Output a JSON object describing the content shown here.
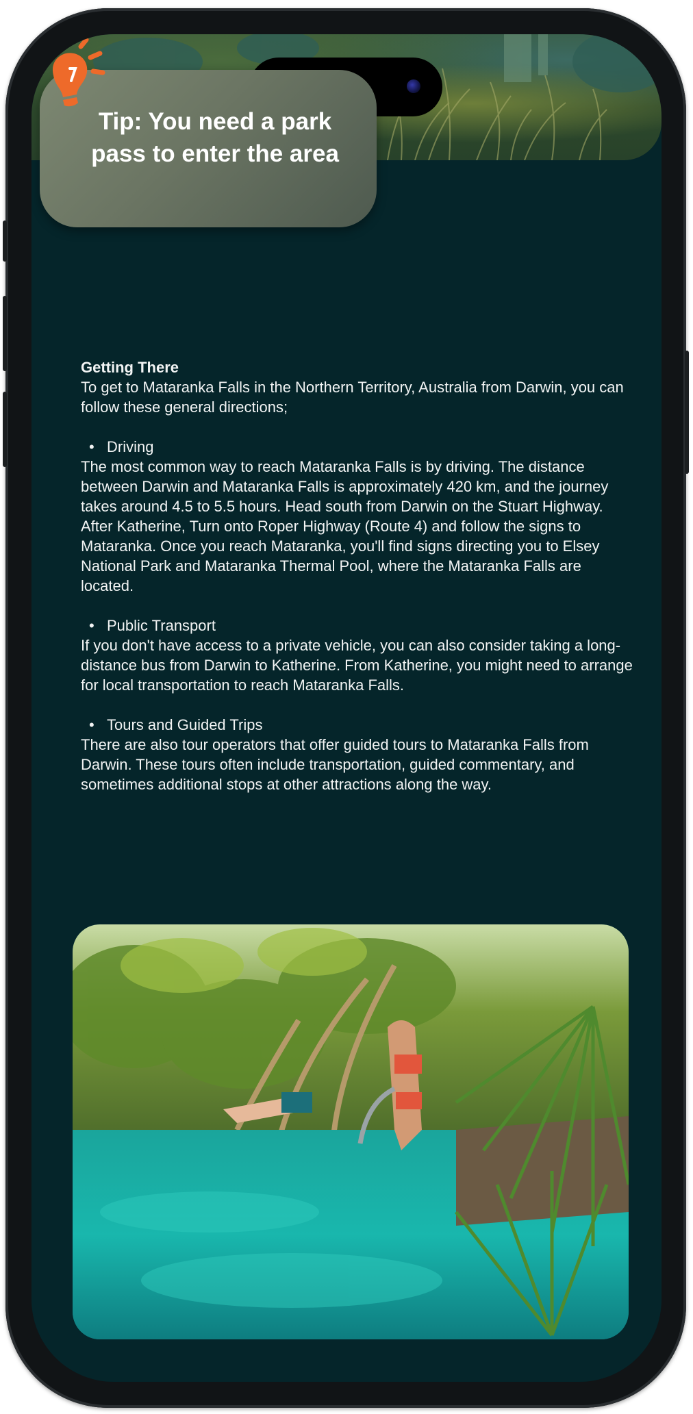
{
  "tip": {
    "line1": "Tip: You need a park",
    "line2": "pass to enter the area",
    "icon": "lightbulb-icon",
    "icon_color": "#ee6a2a"
  },
  "getting_there": {
    "heading": "Getting There",
    "intro": "To get to Mataranka Falls in the Northern Territory, Australia from Darwin, you can follow these general directions;",
    "sections": [
      {
        "title": "Driving",
        "body": "The most common way to reach Mataranka Falls is by driving. The distance between Darwin and Mataranka Falls is approximately 420 km, and the journey takes around 4.5 to 5.5 hours. Head south from Darwin on the Stuart Highway. After Katherine, Turn onto Roper Highway (Route 4) and follow the signs to Mataranka. Once you reach Mataranka, you'll find signs directing you to Elsey National Park and Mataranka Thermal Pool, where the Mataranka Falls are located."
      },
      {
        "title": "Public Transport",
        "body": "If you don't have access to a private vehicle, you can also consider taking a long-distance bus from Darwin to Katherine. From Katherine, you might need to arrange for local transportation to reach Mataranka Falls."
      },
      {
        "title": "Tours and Guided Trips",
        "body": "There are also tour operators that offer guided tours to Mataranka Falls from Darwin. These tours often include transportation, guided commentary, and sometimes additional stops at other attractions along the way."
      }
    ]
  },
  "colors": {
    "background": "#05252a",
    "text": "#f2f4f4"
  }
}
